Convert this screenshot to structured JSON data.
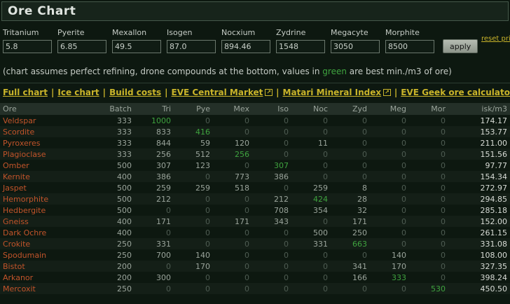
{
  "title": "Ore Chart",
  "toolbar": {
    "apply_label": "apply",
    "reset_label": "reset prices"
  },
  "minerals": [
    {
      "name": "Tritanium",
      "value": "5.8"
    },
    {
      "name": "Pyerite",
      "value": "6.85"
    },
    {
      "name": "Mexallon",
      "value": "49.5"
    },
    {
      "name": "Isogen",
      "value": "87.0"
    },
    {
      "name": "Nocxium",
      "value": "894.46"
    },
    {
      "name": "Zydrine",
      "value": "1548"
    },
    {
      "name": "Megacyte",
      "value": "3050"
    },
    {
      "name": "Morphite",
      "value": "8500"
    }
  ],
  "note": {
    "pre": "(chart assumes perfect refining, drone compounds at the bottom, values in ",
    "green_word": "green",
    "post": " are best min./m3 of ore)"
  },
  "nav": {
    "separator": "|",
    "links": [
      {
        "label": "Full chart",
        "external": false
      },
      {
        "label": "Ice chart",
        "external": false
      },
      {
        "label": "Build costs",
        "external": false
      },
      {
        "label": "EVE Central Market",
        "external": true
      },
      {
        "label": "Matari Mineral Index",
        "external": true
      },
      {
        "label": "EVE Geek ore calculator",
        "external": true
      }
    ]
  },
  "table": {
    "headers": [
      "Ore",
      "Batch",
      "Tri",
      "Pye",
      "Mex",
      "Iso",
      "Noc",
      "Zyd",
      "Meg",
      "Mor",
      "isk/m3"
    ],
    "rows": [
      {
        "ore": "Veldspar",
        "batch": "333",
        "vals": [
          "1000",
          "0",
          "0",
          "0",
          "0",
          "0",
          "0",
          "0"
        ],
        "green": 0,
        "isk": "174.17"
      },
      {
        "ore": "Scordite",
        "batch": "333",
        "vals": [
          "833",
          "416",
          "0",
          "0",
          "0",
          "0",
          "0",
          "0"
        ],
        "green": 1,
        "isk": "153.77"
      },
      {
        "ore": "Pyroxeres",
        "batch": "333",
        "vals": [
          "844",
          "59",
          "120",
          "0",
          "11",
          "0",
          "0",
          "0"
        ],
        "green": -1,
        "isk": "211.00"
      },
      {
        "ore": "Plagioclase",
        "batch": "333",
        "vals": [
          "256",
          "512",
          "256",
          "0",
          "0",
          "0",
          "0",
          "0"
        ],
        "green": 2,
        "isk": "151.56"
      },
      {
        "ore": "Omber",
        "batch": "500",
        "vals": [
          "307",
          "123",
          "0",
          "307",
          "0",
          "0",
          "0",
          "0"
        ],
        "green": 3,
        "isk": "97.77"
      },
      {
        "ore": "Kernite",
        "batch": "400",
        "vals": [
          "386",
          "0",
          "773",
          "386",
          "0",
          "0",
          "0",
          "0"
        ],
        "green": -1,
        "isk": "154.34"
      },
      {
        "ore": "Jaspet",
        "batch": "500",
        "vals": [
          "259",
          "259",
          "518",
          "0",
          "259",
          "8",
          "0",
          "0"
        ],
        "green": -1,
        "isk": "272.97"
      },
      {
        "ore": "Hemorphite",
        "batch": "500",
        "vals": [
          "212",
          "0",
          "0",
          "212",
          "424",
          "28",
          "0",
          "0"
        ],
        "green": 4,
        "isk": "294.85"
      },
      {
        "ore": "Hedbergite",
        "batch": "500",
        "vals": [
          "0",
          "0",
          "0",
          "708",
          "354",
          "32",
          "0",
          "0"
        ],
        "green": -1,
        "isk": "285.18"
      },
      {
        "ore": "Gneiss",
        "batch": "400",
        "vals": [
          "171",
          "0",
          "171",
          "343",
          "0",
          "171",
          "0",
          "0"
        ],
        "green": -1,
        "isk": "152.00"
      },
      {
        "ore": "Dark Ochre",
        "batch": "400",
        "vals": [
          "0",
          "0",
          "0",
          "0",
          "500",
          "250",
          "0",
          "0"
        ],
        "green": -1,
        "isk": "261.15"
      },
      {
        "ore": "Crokite",
        "batch": "250",
        "vals": [
          "331",
          "0",
          "0",
          "0",
          "331",
          "663",
          "0",
          "0"
        ],
        "green": 5,
        "isk": "331.08"
      },
      {
        "ore": "Spodumain",
        "batch": "250",
        "vals": [
          "700",
          "140",
          "0",
          "0",
          "0",
          "0",
          "140",
          "0"
        ],
        "green": -1,
        "isk": "108.00"
      },
      {
        "ore": "Bistot",
        "batch": "200",
        "vals": [
          "0",
          "170",
          "0",
          "0",
          "0",
          "341",
          "170",
          "0"
        ],
        "green": -1,
        "isk": "327.35"
      },
      {
        "ore": "Arkanor",
        "batch": "200",
        "vals": [
          "300",
          "0",
          "0",
          "0",
          "0",
          "166",
          "333",
          "0"
        ],
        "green": 6,
        "isk": "398.24"
      },
      {
        "ore": "Mercoxit",
        "batch": "250",
        "vals": [
          "0",
          "0",
          "0",
          "0",
          "0",
          "0",
          "0",
          "530"
        ],
        "green": 7,
        "isk": "450.50"
      }
    ]
  },
  "colors": {
    "green": "#3fa33f",
    "ore_name": "#c2542a",
    "link": "#c9b42a",
    "value": "#9aa49b",
    "zero": "#4e5c52",
    "isk": "#d8dcd6",
    "header_bg": "#243028",
    "header_text": "#99a39a",
    "page_bg": "#0d1810",
    "title_bg": "#17241b",
    "border": "#45594a"
  }
}
